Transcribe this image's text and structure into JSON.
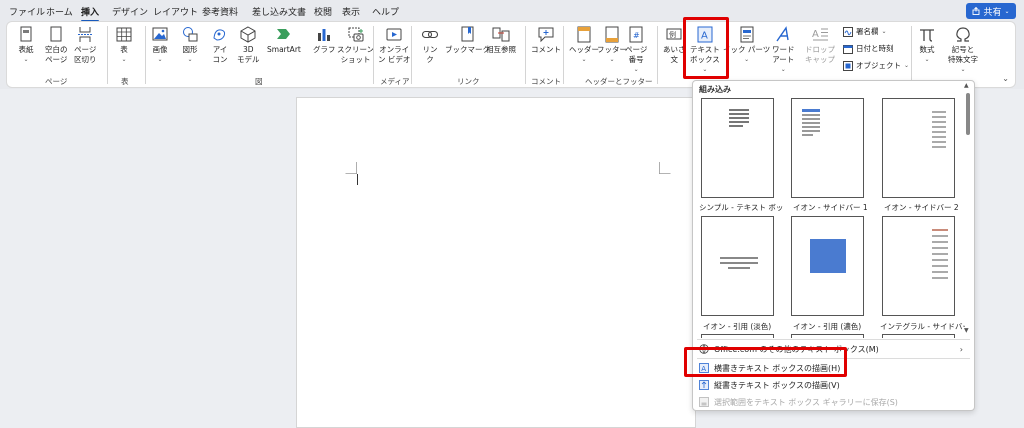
{
  "menubar": {
    "tabs": [
      "ファイル",
      "ホーム",
      "挿入",
      "デザイン",
      "レイアウト",
      "参考資料",
      "差し込み文書",
      "校閲",
      "表示",
      "ヘルプ"
    ],
    "active_tab": "挿入",
    "share_label": "共有"
  },
  "ribbon": {
    "pages": {
      "cover": "表紙",
      "blank": "空白の\nページ",
      "break": "ページ\n区切り",
      "group": "ページ"
    },
    "table": {
      "table": "表",
      "group": "表"
    },
    "illustrations": {
      "picture": "画像",
      "shapes": "図形",
      "icons": "アイ\nコン",
      "model3d": "3D\nモデル",
      "smartart": "SmartArt",
      "chart": "グラフ",
      "screenshot": "スクリーン\nショット",
      "group": "図"
    },
    "media": {
      "video": "オンライ\nン ビデオ",
      "group": "メディア"
    },
    "links": {
      "link": "リン\nク",
      "bookmark": "ブックマーク",
      "crossref": "相互参照",
      "group": "リンク"
    },
    "comments": {
      "comment": "コメント",
      "group": "コメント"
    },
    "header_footer": {
      "header": "ヘッダー",
      "footer": "フッター",
      "page_number": "ページ\n番号",
      "group": "ヘッダーとフッター"
    },
    "text": {
      "greeting": "あいさ\n文",
      "textbox": "テキスト\nボックス",
      "quickparts": "イック パーツ",
      "wordart": "ワード\nアート",
      "dropcap": "ドロップ\nキャップ",
      "signature": "署名欄",
      "datetime": "日付と時刻",
      "object": "オブジェクト"
    },
    "symbols": {
      "equation": "数式",
      "symbol": "記号と\n特殊文字"
    }
  },
  "dropdown": {
    "header": "組み込み",
    "thumbnails": [
      {
        "caption": "シンプル - テキスト ボックス"
      },
      {
        "caption": "イオン - サイドバー 1"
      },
      {
        "caption": "イオン - サイドバー 2"
      },
      {
        "caption": "イオン - 引用 (淡色)"
      },
      {
        "caption": "イオン - 引用 (濃色)"
      },
      {
        "caption": "インテグラル - サイドバー"
      }
    ],
    "menu": {
      "more_office": "Office.com のその他のテキスト ボックス(M)",
      "draw_horizontal": "横書きテキスト ボックスの描画(H)",
      "draw_vertical": "縦書きテキスト ボックスの描画(V)",
      "save_selection": "選択範囲をテキスト ボックス ギャラリーに保存(S)"
    }
  },
  "colors": {
    "accent": "#185abd",
    "share": "#2767d0",
    "highlight": "#e00000",
    "thumb_blue": "#4a7bd0"
  }
}
